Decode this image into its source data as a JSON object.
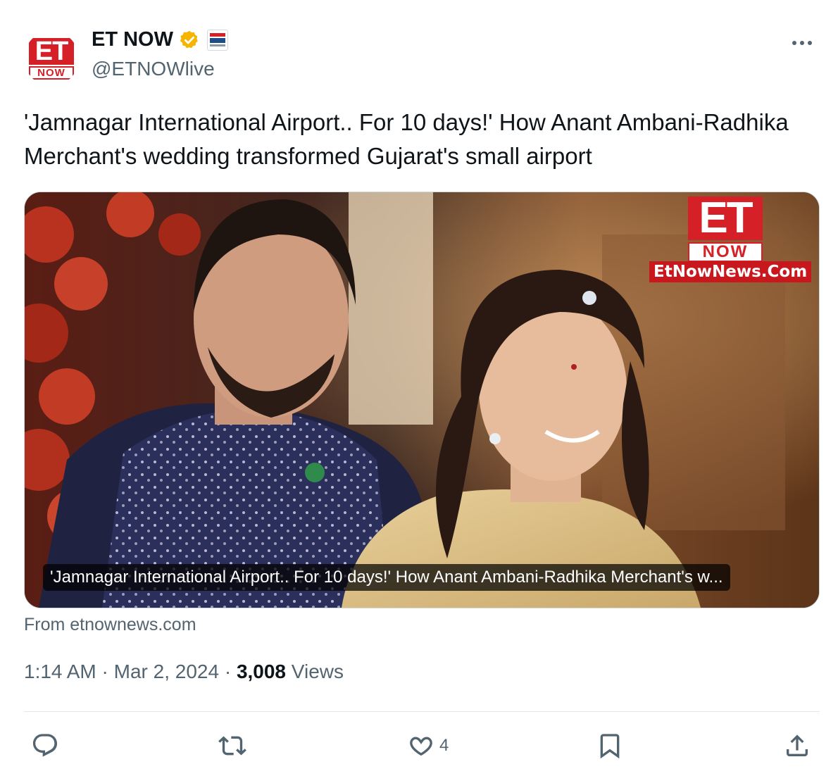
{
  "author": {
    "display_name": "ET NOW",
    "handle": "@ETNOWlive",
    "avatar_logo_top": "ET",
    "avatar_logo_bottom": "NOW",
    "verified_badge_color": "#f4b400"
  },
  "tweet": {
    "text": "'Jamnagar International Airport.. For 10 days!' How Anant Ambani-Radhika Merchant's wedding transformed Gujarat's small airport"
  },
  "card": {
    "brand_top": "ET",
    "brand_bottom": "NOW",
    "brand_url": "EtNowNews.Com",
    "caption": "'Jamnagar International Airport.. For 10 days!' How Anant Ambani-Radhika Merchant's w...",
    "source": "From etnownews.com"
  },
  "meta": {
    "time": "1:14 AM",
    "dot1": "·",
    "date": "Mar 2, 2024",
    "dot2": "·",
    "views_count": "3,008",
    "views_label": "Views"
  },
  "actions": {
    "reply_icon": "reply-icon",
    "retweet_icon": "retweet-icon",
    "like_icon": "like-icon",
    "like_count": "4",
    "bookmark_icon": "bookmark-icon",
    "share_icon": "share-icon"
  },
  "colors": {
    "text_primary": "#0f1419",
    "text_secondary": "#536471",
    "brand_red": "#d62027",
    "divider": "#e1e8ed"
  }
}
